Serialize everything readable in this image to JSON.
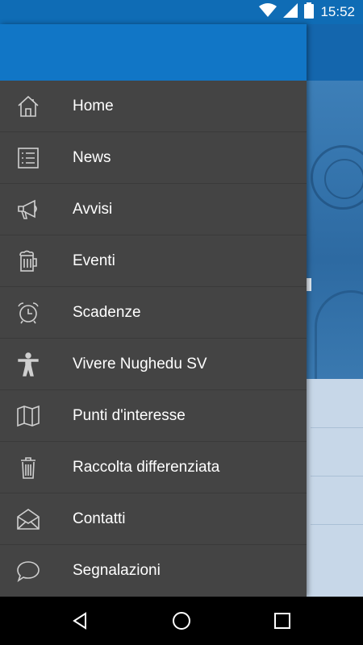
{
  "status_bar": {
    "time": "15:52",
    "icons": [
      "wifi-icon",
      "cell-signal-icon",
      "battery-icon"
    ]
  },
  "drawer": {
    "items": [
      {
        "label": "Home",
        "icon": "home-icon"
      },
      {
        "label": "News",
        "icon": "list-icon"
      },
      {
        "label": "Avvisi",
        "icon": "megaphone-icon"
      },
      {
        "label": "Eventi",
        "icon": "beer-mug-icon"
      },
      {
        "label": "Scadenze",
        "icon": "alarm-clock-icon"
      },
      {
        "label": "Vivere Nughedu SV",
        "icon": "person-icon"
      },
      {
        "label": "Punti d'interesse",
        "icon": "map-icon"
      },
      {
        "label": "Raccolta differenziata",
        "icon": "trash-icon"
      },
      {
        "label": "Contatti",
        "icon": "envelope-icon"
      },
      {
        "label": "Segnalazioni",
        "icon": "chat-bubble-icon"
      }
    ]
  },
  "nav_bar": {
    "buttons": [
      "back-icon",
      "home-circle-icon",
      "recents-icon"
    ]
  },
  "colors": {
    "status_bar": "#0f6cb5",
    "drawer_header": "#1176c6",
    "drawer_bg": "#444444",
    "text": "#ffffff",
    "icon": "#cfcfcf"
  }
}
